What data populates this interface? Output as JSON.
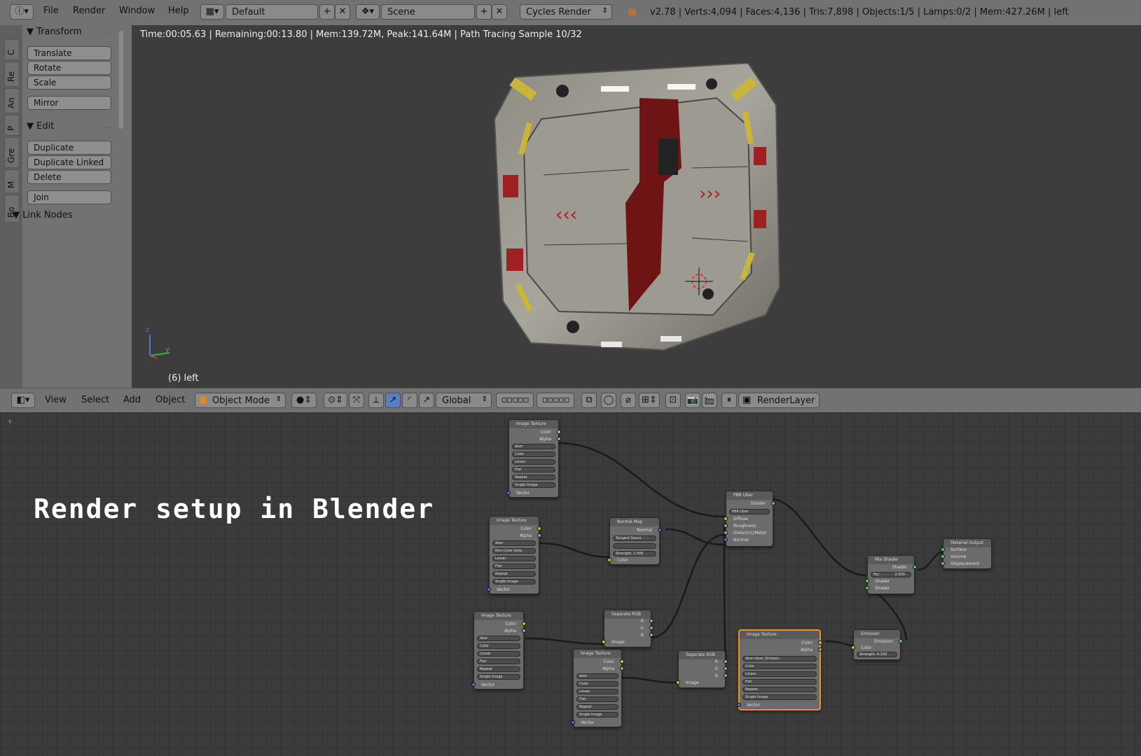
{
  "menu": {
    "items": [
      "File",
      "Render",
      "Window",
      "Help"
    ],
    "layout": "Default",
    "scene": "Scene",
    "engine": "Cycles Render",
    "stats": "v2.78 | Verts:4,094 | Faces:4,136 | Tris:7,898 | Objects:1/5 | Lamps:0/2 | Mem:427.26M | left"
  },
  "tabs": [
    "C",
    "Re",
    "An",
    "P",
    "Gre",
    "M",
    "Bo"
  ],
  "toolshelf": {
    "transform": {
      "title": "Transform",
      "buttons": [
        "Translate",
        "Rotate",
        "Scale",
        "Mirror"
      ]
    },
    "edit": {
      "title": "Edit",
      "buttons": [
        "Duplicate",
        "Duplicate Linked",
        "Delete",
        "Join"
      ]
    },
    "linknodes": {
      "title": "Link Nodes"
    }
  },
  "viewport": {
    "status": "Time:00:05.63 | Remaining:00:13.80 | Mem:139.72M, Peak:141.64M | Path Tracing Sample 10/32",
    "view_label": "(6) left",
    "axis_z": "z",
    "axis_y": "y"
  },
  "header3d": {
    "menus": [
      "View",
      "Select",
      "Add",
      "Object"
    ],
    "mode": "Object Mode",
    "orientation": "Global",
    "renderlayer": "RenderLayer"
  },
  "node_editor": {
    "caption": "Render setup in Blender",
    "nodes": {
      "img1": {
        "title": "Image Texture",
        "out": [
          "Color",
          "Alpha"
        ],
        "image": "door",
        "fields": [
          "Color",
          "Linear",
          "Flat",
          "Repeat",
          "Single Image"
        ],
        "in": "Vector"
      },
      "img2": {
        "title": "Image Texture",
        "out": [
          "Color",
          "Alpha"
        ],
        "image": "door",
        "fields": [
          "Non-Color Data",
          "Linear",
          "Flat",
          "Repeat",
          "Single Image"
        ],
        "in": "Vector"
      },
      "img3": {
        "title": "Image Texture",
        "out": [
          "Color",
          "Alpha"
        ],
        "image": "door",
        "fields": [
          "Color",
          "Linear",
          "Flat",
          "Repeat",
          "Single Image"
        ],
        "in": "Vector"
      },
      "img4": {
        "title": "Image Texture",
        "out": [
          "Color",
          "Alpha"
        ],
        "image": "door",
        "fields": [
          "Color",
          "Linear",
          "Flat",
          "Repeat",
          "Single Image"
        ],
        "in": "Vector"
      },
      "img5": {
        "title": "Image Texture",
        "out": [
          "Color",
          "Alpha"
        ],
        "image": "door-clean_Emissiv...",
        "fields": [
          "Color",
          "Linear",
          "Flat",
          "Repeat",
          "Single Image"
        ],
        "in": "Vector"
      },
      "normalmap": {
        "title": "Normal Map",
        "out": "Normal",
        "space": "Tangent Space",
        "strength": "Strength:   1.000",
        "in": "Color"
      },
      "pbr": {
        "title": "PBR Uber",
        "out": "Shader",
        "group": "PBR Uber",
        "in": [
          "Diffuse",
          "Roughness",
          "Dielectric/Metal",
          "Normal"
        ]
      },
      "sep1": {
        "title": "Separate RGB",
        "out": [
          "R",
          "G",
          "B"
        ],
        "in": "Image"
      },
      "sep2": {
        "title": "Separate RGB",
        "out": [
          "R",
          "G",
          "B"
        ],
        "in": "Image"
      },
      "mix": {
        "title": "Mix Shader",
        "out": "Shader",
        "fac": "Fac:",
        "fac_value": "0.500",
        "in": [
          "Shader",
          "Shader"
        ]
      },
      "emission": {
        "title": "Emission",
        "out": "Emission",
        "in": "Color",
        "strength": "Strength: 4.100"
      },
      "output": {
        "title": "Material Output",
        "in": [
          "Surface",
          "Volume",
          "Displacement"
        ]
      }
    }
  }
}
